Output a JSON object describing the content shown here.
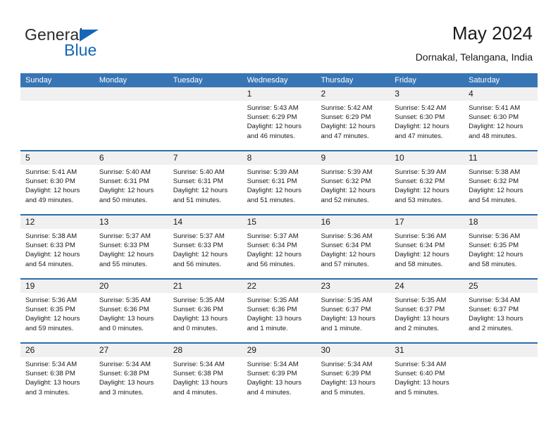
{
  "brand": {
    "name_part1": "General",
    "name_part2": "Blue",
    "triangle_color": "#1565b8"
  },
  "header": {
    "title": "May 2024",
    "subtitle": "Dornakal, Telangana, India"
  },
  "theme": {
    "header_blue": "#3875b5",
    "row_border_blue": "#2f6cac",
    "day_band_gray": "#f0f0f0",
    "text_color": "#1a1a1a"
  },
  "weekdays": [
    "Sunday",
    "Monday",
    "Tuesday",
    "Wednesday",
    "Thursday",
    "Friday",
    "Saturday"
  ],
  "labels": {
    "sunrise_prefix": "Sunrise:",
    "sunset_prefix": "Sunset:",
    "daylight_prefix": "Daylight:"
  },
  "weeks": [
    [
      {
        "day": "",
        "empty": true
      },
      {
        "day": "",
        "empty": true
      },
      {
        "day": "",
        "empty": true
      },
      {
        "day": "1",
        "sunrise": "Sunrise: 5:43 AM",
        "sunset": "Sunset: 6:29 PM",
        "daylight1": "Daylight: 12 hours",
        "daylight2": "and 46 minutes."
      },
      {
        "day": "2",
        "sunrise": "Sunrise: 5:42 AM",
        "sunset": "Sunset: 6:29 PM",
        "daylight1": "Daylight: 12 hours",
        "daylight2": "and 47 minutes."
      },
      {
        "day": "3",
        "sunrise": "Sunrise: 5:42 AM",
        "sunset": "Sunset: 6:30 PM",
        "daylight1": "Daylight: 12 hours",
        "daylight2": "and 47 minutes."
      },
      {
        "day": "4",
        "sunrise": "Sunrise: 5:41 AM",
        "sunset": "Sunset: 6:30 PM",
        "daylight1": "Daylight: 12 hours",
        "daylight2": "and 48 minutes."
      }
    ],
    [
      {
        "day": "5",
        "sunrise": "Sunrise: 5:41 AM",
        "sunset": "Sunset: 6:30 PM",
        "daylight1": "Daylight: 12 hours",
        "daylight2": "and 49 minutes."
      },
      {
        "day": "6",
        "sunrise": "Sunrise: 5:40 AM",
        "sunset": "Sunset: 6:31 PM",
        "daylight1": "Daylight: 12 hours",
        "daylight2": "and 50 minutes."
      },
      {
        "day": "7",
        "sunrise": "Sunrise: 5:40 AM",
        "sunset": "Sunset: 6:31 PM",
        "daylight1": "Daylight: 12 hours",
        "daylight2": "and 51 minutes."
      },
      {
        "day": "8",
        "sunrise": "Sunrise: 5:39 AM",
        "sunset": "Sunset: 6:31 PM",
        "daylight1": "Daylight: 12 hours",
        "daylight2": "and 51 minutes."
      },
      {
        "day": "9",
        "sunrise": "Sunrise: 5:39 AM",
        "sunset": "Sunset: 6:32 PM",
        "daylight1": "Daylight: 12 hours",
        "daylight2": "and 52 minutes."
      },
      {
        "day": "10",
        "sunrise": "Sunrise: 5:39 AM",
        "sunset": "Sunset: 6:32 PM",
        "daylight1": "Daylight: 12 hours",
        "daylight2": "and 53 minutes."
      },
      {
        "day": "11",
        "sunrise": "Sunrise: 5:38 AM",
        "sunset": "Sunset: 6:32 PM",
        "daylight1": "Daylight: 12 hours",
        "daylight2": "and 54 minutes."
      }
    ],
    [
      {
        "day": "12",
        "sunrise": "Sunrise: 5:38 AM",
        "sunset": "Sunset: 6:33 PM",
        "daylight1": "Daylight: 12 hours",
        "daylight2": "and 54 minutes."
      },
      {
        "day": "13",
        "sunrise": "Sunrise: 5:37 AM",
        "sunset": "Sunset: 6:33 PM",
        "daylight1": "Daylight: 12 hours",
        "daylight2": "and 55 minutes."
      },
      {
        "day": "14",
        "sunrise": "Sunrise: 5:37 AM",
        "sunset": "Sunset: 6:33 PM",
        "daylight1": "Daylight: 12 hours",
        "daylight2": "and 56 minutes."
      },
      {
        "day": "15",
        "sunrise": "Sunrise: 5:37 AM",
        "sunset": "Sunset: 6:34 PM",
        "daylight1": "Daylight: 12 hours",
        "daylight2": "and 56 minutes."
      },
      {
        "day": "16",
        "sunrise": "Sunrise: 5:36 AM",
        "sunset": "Sunset: 6:34 PM",
        "daylight1": "Daylight: 12 hours",
        "daylight2": "and 57 minutes."
      },
      {
        "day": "17",
        "sunrise": "Sunrise: 5:36 AM",
        "sunset": "Sunset: 6:34 PM",
        "daylight1": "Daylight: 12 hours",
        "daylight2": "and 58 minutes."
      },
      {
        "day": "18",
        "sunrise": "Sunrise: 5:36 AM",
        "sunset": "Sunset: 6:35 PM",
        "daylight1": "Daylight: 12 hours",
        "daylight2": "and 58 minutes."
      }
    ],
    [
      {
        "day": "19",
        "sunrise": "Sunrise: 5:36 AM",
        "sunset": "Sunset: 6:35 PM",
        "daylight1": "Daylight: 12 hours",
        "daylight2": "and 59 minutes."
      },
      {
        "day": "20",
        "sunrise": "Sunrise: 5:35 AM",
        "sunset": "Sunset: 6:36 PM",
        "daylight1": "Daylight: 13 hours",
        "daylight2": "and 0 minutes."
      },
      {
        "day": "21",
        "sunrise": "Sunrise: 5:35 AM",
        "sunset": "Sunset: 6:36 PM",
        "daylight1": "Daylight: 13 hours",
        "daylight2": "and 0 minutes."
      },
      {
        "day": "22",
        "sunrise": "Sunrise: 5:35 AM",
        "sunset": "Sunset: 6:36 PM",
        "daylight1": "Daylight: 13 hours",
        "daylight2": "and 1 minute."
      },
      {
        "day": "23",
        "sunrise": "Sunrise: 5:35 AM",
        "sunset": "Sunset: 6:37 PM",
        "daylight1": "Daylight: 13 hours",
        "daylight2": "and 1 minute."
      },
      {
        "day": "24",
        "sunrise": "Sunrise: 5:35 AM",
        "sunset": "Sunset: 6:37 PM",
        "daylight1": "Daylight: 13 hours",
        "daylight2": "and 2 minutes."
      },
      {
        "day": "25",
        "sunrise": "Sunrise: 5:34 AM",
        "sunset": "Sunset: 6:37 PM",
        "daylight1": "Daylight: 13 hours",
        "daylight2": "and 2 minutes."
      }
    ],
    [
      {
        "day": "26",
        "sunrise": "Sunrise: 5:34 AM",
        "sunset": "Sunset: 6:38 PM",
        "daylight1": "Daylight: 13 hours",
        "daylight2": "and 3 minutes."
      },
      {
        "day": "27",
        "sunrise": "Sunrise: 5:34 AM",
        "sunset": "Sunset: 6:38 PM",
        "daylight1": "Daylight: 13 hours",
        "daylight2": "and 3 minutes."
      },
      {
        "day": "28",
        "sunrise": "Sunrise: 5:34 AM",
        "sunset": "Sunset: 6:38 PM",
        "daylight1": "Daylight: 13 hours",
        "daylight2": "and 4 minutes."
      },
      {
        "day": "29",
        "sunrise": "Sunrise: 5:34 AM",
        "sunset": "Sunset: 6:39 PM",
        "daylight1": "Daylight: 13 hours",
        "daylight2": "and 4 minutes."
      },
      {
        "day": "30",
        "sunrise": "Sunrise: 5:34 AM",
        "sunset": "Sunset: 6:39 PM",
        "daylight1": "Daylight: 13 hours",
        "daylight2": "and 5 minutes."
      },
      {
        "day": "31",
        "sunrise": "Sunrise: 5:34 AM",
        "sunset": "Sunset: 6:40 PM",
        "daylight1": "Daylight: 13 hours",
        "daylight2": "and 5 minutes."
      },
      {
        "day": "",
        "empty": true
      }
    ]
  ]
}
